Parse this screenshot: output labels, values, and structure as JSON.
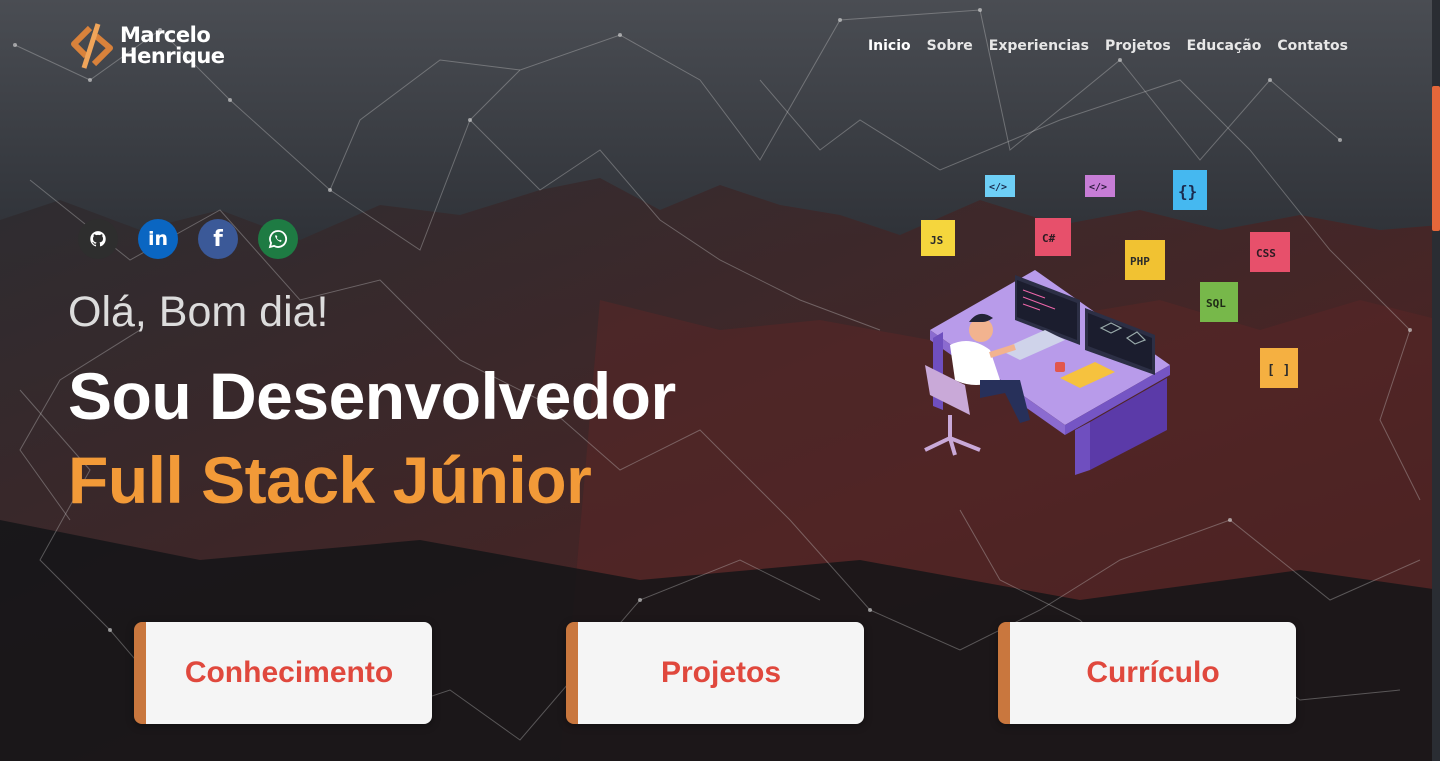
{
  "brand": {
    "first": "Marcelo",
    "last": "Henrique"
  },
  "nav": [
    {
      "label": "Inicio",
      "active": true
    },
    {
      "label": "Sobre"
    },
    {
      "label": "Experiencias"
    },
    {
      "label": "Projetos"
    },
    {
      "label": "Educação"
    },
    {
      "label": "Contatos"
    }
  ],
  "socials": [
    {
      "icon": "github-icon"
    },
    {
      "icon": "linkedin-icon",
      "glyph": "in"
    },
    {
      "icon": "facebook-icon",
      "glyph": "f"
    },
    {
      "icon": "whatsapp-icon"
    }
  ],
  "hero": {
    "greeting": "Olá, Bom dia!",
    "line1": "Sou Desenvolvedor",
    "line2": "Full Stack Júnior"
  },
  "illustration": {
    "tags": [
      "</>",
      "</>",
      "{}",
      "JS",
      "C#",
      "PHP",
      "CSS",
      "SQL",
      "[ ]"
    ]
  },
  "cards": [
    {
      "label": "Conhecimento"
    },
    {
      "label": "Projetos"
    },
    {
      "label": "Currículo"
    }
  ],
  "colors": {
    "accent": "#f29a38",
    "card_text": "#e0483d",
    "card_border": "#c9773e"
  }
}
